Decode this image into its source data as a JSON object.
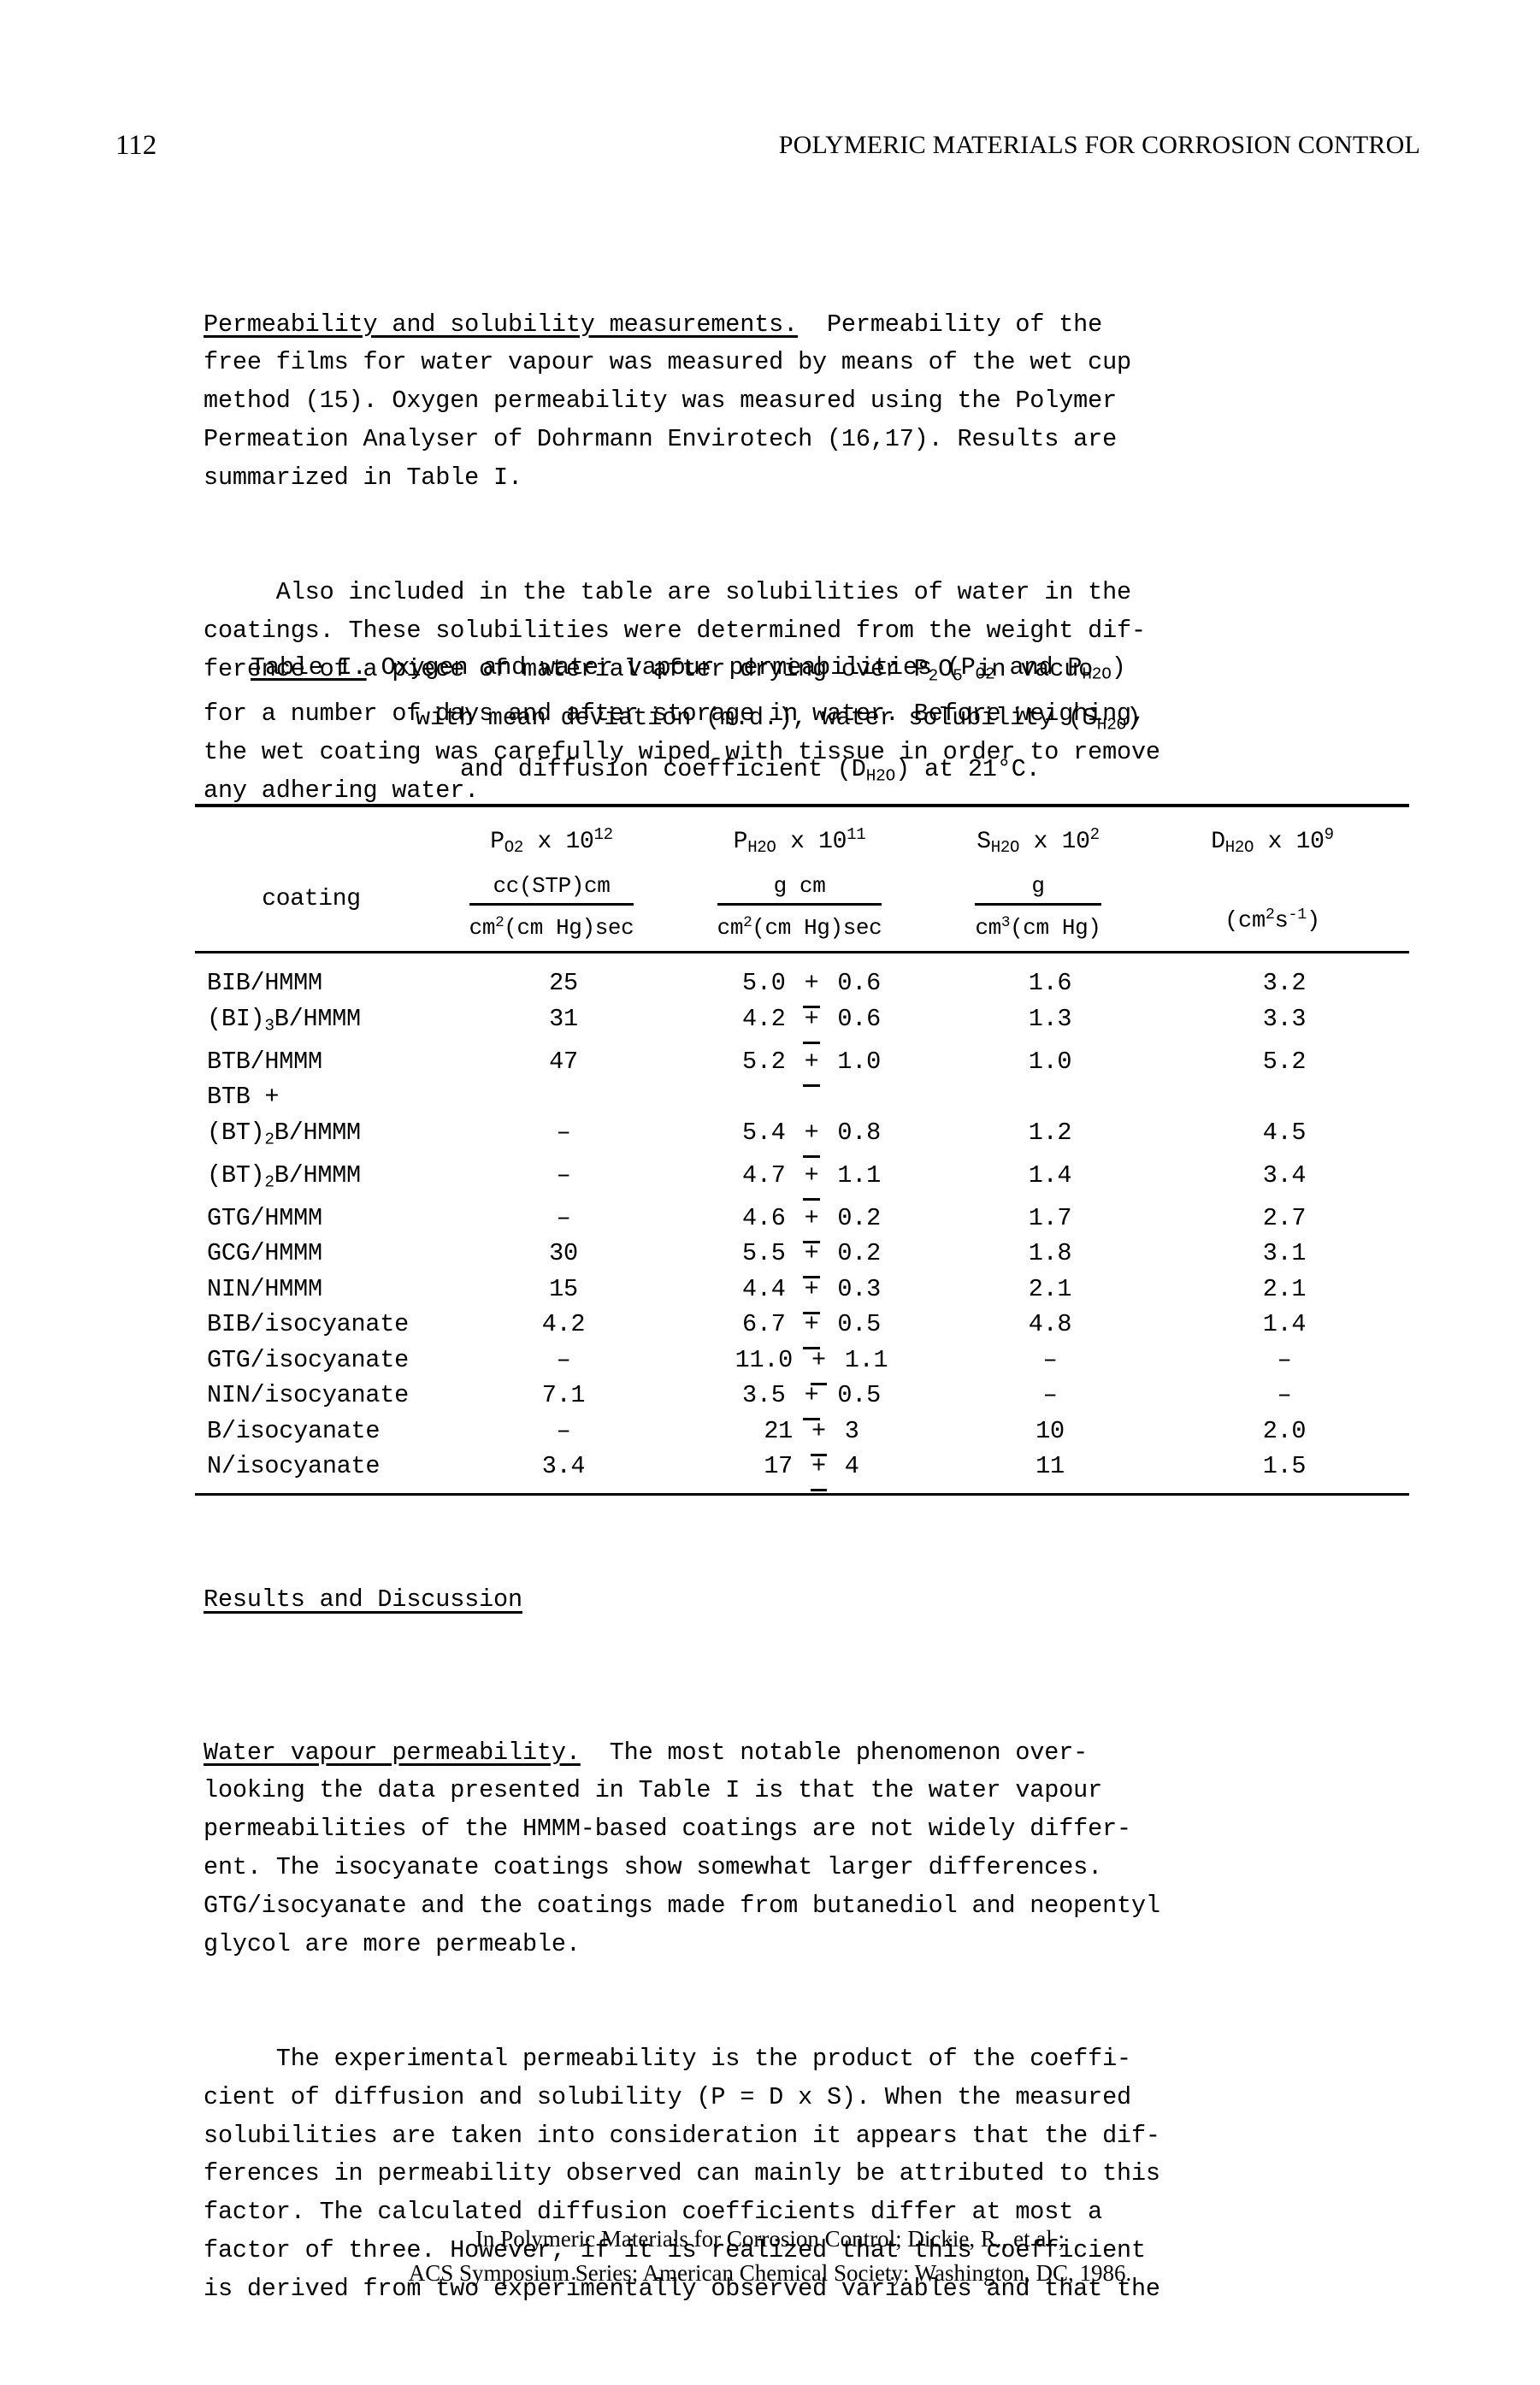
{
  "running_head": {
    "folio": "112",
    "title": "POLYMERIC MATERIALS FOR CORROSION CONTROL"
  },
  "body_top": {
    "para1_runin": "Permeability and solubility measurements.",
    "para1_lines": [
      "  Permeability of the",
      "free films for water vapour was measured by means of the wet cup",
      "method (15). Oxygen permeability was measured using the Polymer",
      "Permeation Analyser of Dohrmann Envirotech (16,17). Results are",
      "summarized in Table I."
    ],
    "para2_line1": "     Also included in the table are solubilities of water in the",
    "para2_line2": "coatings. These solubilities were determined from the weight dif-",
    "para2_line3_a": "ference of a piece of material after drying over P",
    "para2_line3_sub1": "2",
    "para2_line3_b": "O",
    "para2_line3_sub2": "5",
    "para2_line3_c": " in vacuo",
    "para2_line4": "for a number of days and after storage in water. Before weighing,",
    "para2_line5": "the wet coating was carefully wiped with tissue in order to remove",
    "para2_line6": "any adhering water."
  },
  "table_caption": {
    "label": "Table I.",
    "l1_a": "  Oxygen and water vapour permeabilities (P",
    "l1_sub1": "O2",
    "l1_b": " and P",
    "l1_sub2": "H2O",
    "l1_c": ")",
    "l2_a": "with mean deviation (m.d.), water solubility (S",
    "l2_sub": "H2O",
    "l2_b": ")",
    "l3_a": "and diffusion coefficient (D",
    "l3_sub": "H2O",
    "l3_b": ") at 21°C."
  },
  "table": {
    "headers": {
      "coating": "coating",
      "col2": {
        "symbol": "P",
        "sub": "O2",
        "factor": " x 10",
        "exp": "12",
        "unit_num": "cc(STP)cm",
        "unit_den_a": "cm",
        "unit_den_sup": "2",
        "unit_den_b": "(cm Hg)sec"
      },
      "col3": {
        "symbol": "P",
        "sub": "H2O",
        "factor": " x 10",
        "exp": "11",
        "unit_num": "g cm",
        "unit_den_a": "cm",
        "unit_den_sup": "2",
        "unit_den_b": "(cm Hg)sec"
      },
      "col4": {
        "symbol": "S",
        "sub": "H2O",
        "factor": " x 10",
        "exp": "2",
        "unit_num": "g",
        "unit_den_a": "cm",
        "unit_den_sup": "3",
        "unit_den_b": "(cm Hg)"
      },
      "col5": {
        "symbol": "D",
        "sub": "H2O",
        "factor": " x 10",
        "exp": "9",
        "unit_a": "(cm",
        "unit_sup1": "2",
        "unit_b": "s",
        "unit_sup2": "-1",
        "unit_c": ")"
      }
    },
    "rows": [
      {
        "name_a": "BIB/HMMM",
        "name_sub": "",
        "name_b": "",
        "po2": "25",
        "ph2o_val": "5.0",
        "ph2o_err": "0.6",
        "sh2o": "1.6",
        "dh2o": "3.2"
      },
      {
        "name_a": "(BI)",
        "name_sub": "3",
        "name_b": "B/HMMM",
        "po2": "31",
        "ph2o_val": "4.2",
        "ph2o_err": "0.6",
        "sh2o": "1.3",
        "dh2o": "3.3"
      },
      {
        "name_a": "BTB/HMMM",
        "name_sub": "",
        "name_b": "",
        "po2": "47",
        "ph2o_val": "5.2",
        "ph2o_err": "1.0",
        "sh2o": "1.0",
        "dh2o": "5.2"
      },
      {
        "name_a": "BTB +",
        "name_sub": "",
        "name_b": "",
        "po2": "",
        "ph2o_val": "",
        "ph2o_err": "",
        "sh2o": "",
        "dh2o": ""
      },
      {
        "name_a": "(BT)",
        "name_sub": "2",
        "name_b": "B/HMMM",
        "po2": "–",
        "ph2o_val": "5.4",
        "ph2o_err": "0.8",
        "sh2o": "1.2",
        "dh2o": "4.5"
      },
      {
        "name_a": "(BT)",
        "name_sub": "2",
        "name_b": "B/HMMM",
        "po2": "–",
        "ph2o_val": "4.7",
        "ph2o_err": "1.1",
        "sh2o": "1.4",
        "dh2o": "3.4"
      },
      {
        "name_a": "GTG/HMMM",
        "name_sub": "",
        "name_b": "",
        "po2": "–",
        "ph2o_val": "4.6",
        "ph2o_err": "0.2",
        "sh2o": "1.7",
        "dh2o": "2.7"
      },
      {
        "name_a": "GCG/HMMM",
        "name_sub": "",
        "name_b": "",
        "po2": "30",
        "ph2o_val": "5.5",
        "ph2o_err": "0.2",
        "sh2o": "1.8",
        "dh2o": "3.1"
      },
      {
        "name_a": "NIN/HMMM",
        "name_sub": "",
        "name_b": "",
        "po2": "15",
        "ph2o_val": "4.4",
        "ph2o_err": "0.3",
        "sh2o": "2.1",
        "dh2o": "2.1"
      },
      {
        "name_a": "BIB/isocyanate",
        "name_sub": "",
        "name_b": "",
        "po2": "4.2",
        "ph2o_val": "6.7",
        "ph2o_err": "0.5",
        "sh2o": "4.8",
        "dh2o": "1.4"
      },
      {
        "name_a": "GTG/isocyanate",
        "name_sub": "",
        "name_b": "",
        "po2": "–",
        "ph2o_val": "11.0",
        "ph2o_err": "1.1",
        "sh2o": "–",
        "dh2o": "–"
      },
      {
        "name_a": "NIN/isocyanate",
        "name_sub": "",
        "name_b": "",
        "po2": "7.1",
        "ph2o_val": "3.5",
        "ph2o_err": "0.5",
        "sh2o": "–",
        "dh2o": "–"
      },
      {
        "name_a": "B/isocyanate",
        "name_sub": "",
        "name_b": "",
        "po2": "–",
        "ph2o_val": "21",
        "ph2o_err": "3",
        "sh2o": "10",
        "dh2o": "2.0"
      },
      {
        "name_a": "N/isocyanate",
        "name_sub": "",
        "name_b": "",
        "po2": "3.4",
        "ph2o_val": "17",
        "ph2o_err": "4",
        "sh2o": "11",
        "dh2o": "1.5"
      }
    ]
  },
  "section_heading": "Results and Discussion",
  "body_bottom": {
    "para1_runin": "Water vapour permeability.",
    "para1_lines": [
      "  The most notable phenomenon over-",
      "looking the data presented in Table I is that the water vapour",
      "permeabilities of the HMMM-based coatings are not widely differ-",
      "ent. The isocyanate coatings show somewhat larger differences.",
      "GTG/isocyanate and the coatings made from butanediol and neopentyl",
      "glycol are more permeable."
    ],
    "para2_lines": [
      "     The experimental permeability is the product of the coeffi-",
      "cient of diffusion and solubility (P = D x S). When the measured",
      "solubilities are taken into consideration it appears that the dif-",
      "ferences in permeability observed can mainly be attributed to this",
      "factor. The calculated diffusion coefficients differ at most a",
      "factor of three. However, if it is realized that this coefficient",
      "is derived from two experimentally observed variables and that the"
    ]
  },
  "footer": {
    "line1": "In Polymeric Materials for Corrosion Control; Dickie, R., et al.;",
    "line2": "ACS Symposium Series; American Chemical Society: Washington, DC, 1986."
  }
}
